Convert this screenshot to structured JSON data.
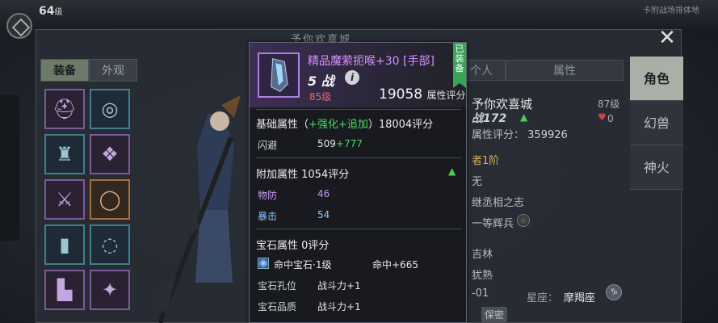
{
  "hud": {
    "level": "64",
    "level_unit": "级",
    "top_right": "卡附战场排体地"
  },
  "window": {
    "title": "予你欢喜城",
    "close_icon": "close-icon"
  },
  "left_tabs": {
    "equip": "装备",
    "appearance": "外观"
  },
  "equip_slots": [
    {
      "icon": "helmet-icon",
      "rarity": "purple"
    },
    {
      "icon": "necklace-icon",
      "rarity": "blue"
    },
    {
      "icon": "armor-icon",
      "rarity": "blue"
    },
    {
      "icon": "amulet-icon",
      "rarity": "purple"
    },
    {
      "icon": "bracer-icon",
      "rarity": "purple"
    },
    {
      "icon": "ring-icon",
      "rarity": "orange"
    },
    {
      "icon": "leggings-icon",
      "rarity": "blue"
    },
    {
      "icon": "ring2-icon",
      "rarity": "blue"
    },
    {
      "icon": "boots-icon",
      "rarity": "purple"
    },
    {
      "icon": "charm-icon",
      "rarity": "purple"
    }
  ],
  "tooltip": {
    "name": "精品魔萦扼喉+30 [手部]",
    "rank": "5 战",
    "level": "85级",
    "score": "19058",
    "score_unit": "属性评分",
    "equipped_badge": "已装备",
    "base": {
      "label": "基础属性（",
      "strengthen": "+强化",
      "add": "+追加",
      "tail": "）18004评分",
      "stats": [
        {
          "k": "闪避",
          "v": "509",
          "extra": "+777"
        }
      ]
    },
    "extra": {
      "label": "附加属性 1054评分",
      "stats": [
        {
          "k": "物防",
          "v": "46",
          "color": "purple"
        },
        {
          "k": "暴击",
          "v": "54",
          "color": "blue"
        }
      ]
    },
    "gem": {
      "label": "宝石属性 0评分",
      "gem_name": "命中宝石·1级",
      "gem_value": "命中+665",
      "slot_label": "宝石孔位",
      "slot_value": "战斗力+1",
      "quality_label": "宝石品质",
      "quality_value": "战斗力+1"
    }
  },
  "right_tabs": {
    "person": "个人",
    "attr": "属性"
  },
  "side_tabs": [
    "角色",
    "幻兽",
    "神火"
  ],
  "profile": {
    "name": "予你欢喜城",
    "level": "87级",
    "cp": "战172",
    "likes": "0",
    "score_label": "属性评分：",
    "score": "359926",
    "rows": [
      "者1阶",
      "无",
      "继丞相之志",
      "一等辉兵",
      "吉林",
      "犹熟",
      "-01"
    ],
    "star_label": "星座：",
    "star_value": "摩羯座",
    "zodiac_symbol": "♑",
    "secret": "保密"
  },
  "colors": {
    "purple_quality": "#d890ff",
    "green_up": "#4ad66a",
    "active_tab": "#6d7a67"
  }
}
